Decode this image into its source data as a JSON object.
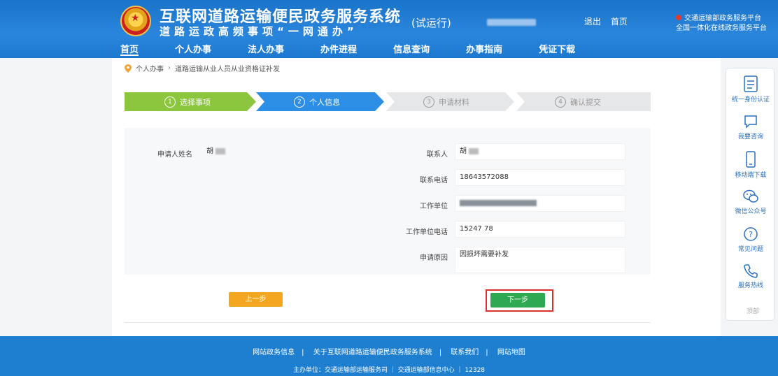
{
  "header": {
    "title": "互联网道路运输便民政务服务系统",
    "subtitle": "道路运政高频事项“一网通办”",
    "trial": "(试运行)",
    "links": [
      "退出",
      "首页"
    ],
    "org_line1": "交通运输部政务服务平台",
    "org_line2": "全国一体化在线政务服务平台"
  },
  "nav": {
    "items": [
      "首页",
      "个人办事",
      "法人办事",
      "办件进程",
      "信息查询",
      "办事指南",
      "凭证下载"
    ]
  },
  "breadcrumb": {
    "level1": "个人办事",
    "level2": "道路运输从业人员从业资格证补发"
  },
  "steps": [
    {
      "num": "1",
      "label": "选择事项"
    },
    {
      "num": "2",
      "label": "个人信息"
    },
    {
      "num": "3",
      "label": "申请材料"
    },
    {
      "num": "4",
      "label": "确认提交"
    }
  ],
  "form": {
    "applicant_label": "申请人姓名",
    "applicant_value": "胡",
    "contact_label": "联系人",
    "contact_value": "胡",
    "phone_label": "联系电话",
    "phone_value": "18643572088",
    "work_unit_label": "工作单位",
    "work_unit_phone_label": "工作单位电话",
    "work_unit_phone_value": "15247      78",
    "reason_label": "申请原因",
    "reason_value": "因损坏需要补发"
  },
  "buttons": {
    "prev": "上一步",
    "next": "下一步"
  },
  "side_panel": {
    "items": [
      "统一身份认证",
      "我要咨询",
      "移动端下载",
      "微信公众号",
      "常见问题",
      "服务热线"
    ],
    "bottom": "顶部"
  },
  "footer": {
    "links": [
      "网站政务信息",
      "关于互联网道路运输便民政务服务系统",
      "联系我们",
      "网站地图"
    ],
    "info": "主办单位：交通运输部运输服务司 ｜ 交通运输部信息中心 ｜ 12328"
  },
  "colors": {
    "header_blue": "#1a73c9",
    "step_done": "#8cc63f",
    "step_current": "#2d8ee6",
    "step_todo": "#e6e7e9",
    "btn_prev": "#f3a721",
    "btn_next": "#2fa951",
    "highlight": "#d9332a"
  }
}
